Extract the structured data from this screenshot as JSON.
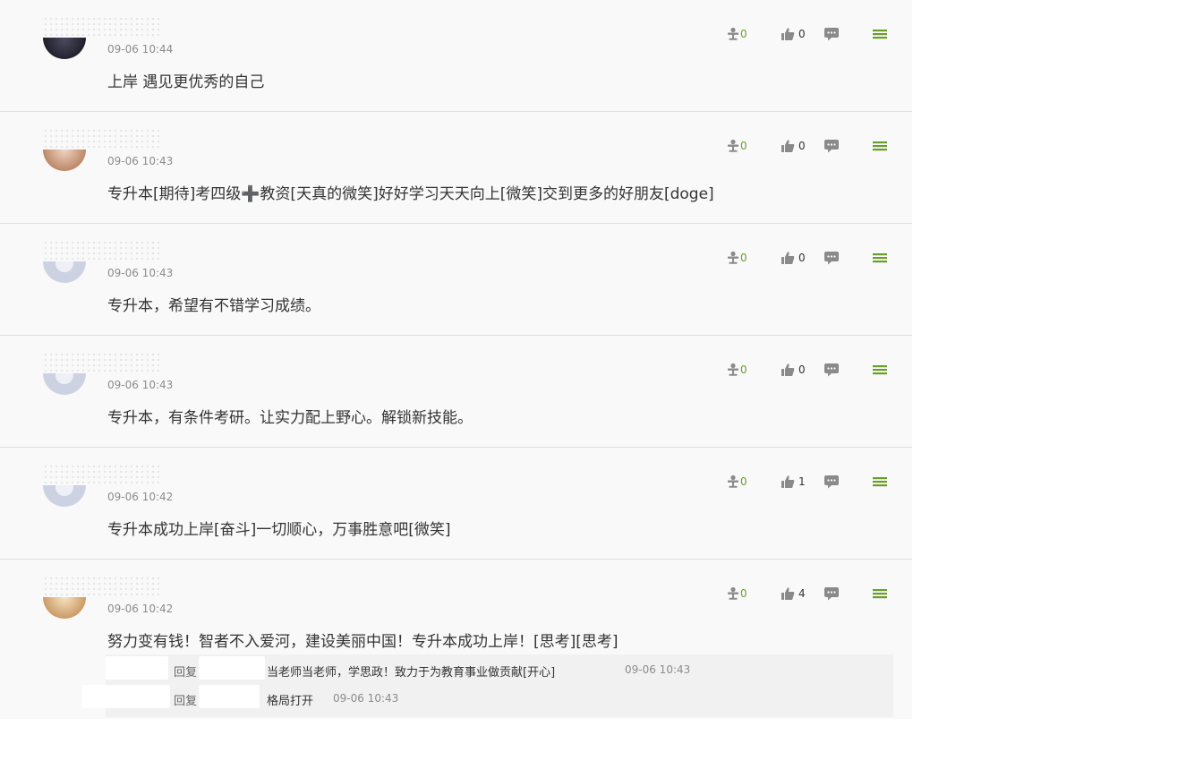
{
  "comments": [
    {
      "time": "09-06 10:44",
      "text": "上岸 遇见更优秀的自己",
      "reward": "0",
      "likes": "0"
    },
    {
      "time": "09-06 10:43",
      "text": "专升本[期待]考四级➕教资[天真的微笑]好好学习天天向上[微笑]交到更多的好朋友[doge]",
      "reward": "0",
      "likes": "0"
    },
    {
      "time": "09-06 10:43",
      "text": "专升本，希望有不错学习成绩。",
      "reward": "0",
      "likes": "0"
    },
    {
      "time": "09-06 10:43",
      "text": "专升本，有条件考研。让实力配上野心。解锁新技能。",
      "reward": "0",
      "likes": "0"
    },
    {
      "time": "09-06 10:42",
      "text": "专升本成功上岸[奋斗]一切顺心，万事胜意吧[微笑]",
      "reward": "0",
      "likes": "1"
    },
    {
      "time": "09-06 10:42",
      "text": "努力变有钱！智者不入爱河，建设美丽中国！专升本成功上岸！[思考][思考]",
      "reward": "0",
      "likes": "4"
    }
  ],
  "replies": [
    {
      "prefix": "回复",
      "text": "当老师当老师，学思政！致力于为教育事业做贡献[开心]",
      "time": "09-06 10:43"
    },
    {
      "prefix": "回复",
      "text": "格局打开",
      "time": "09-06 10:43"
    }
  ],
  "icons": {
    "reward": "reward-icon",
    "like": "thumbs-up-icon",
    "reply": "comment-bubble-icon",
    "menu": "menu-icon"
  },
  "colors": {
    "accent_green": "#6a9e2c",
    "icon_gray": "#8a8a8a",
    "feed_background": "#f9f9f9",
    "divider": "#dfdfdf"
  }
}
